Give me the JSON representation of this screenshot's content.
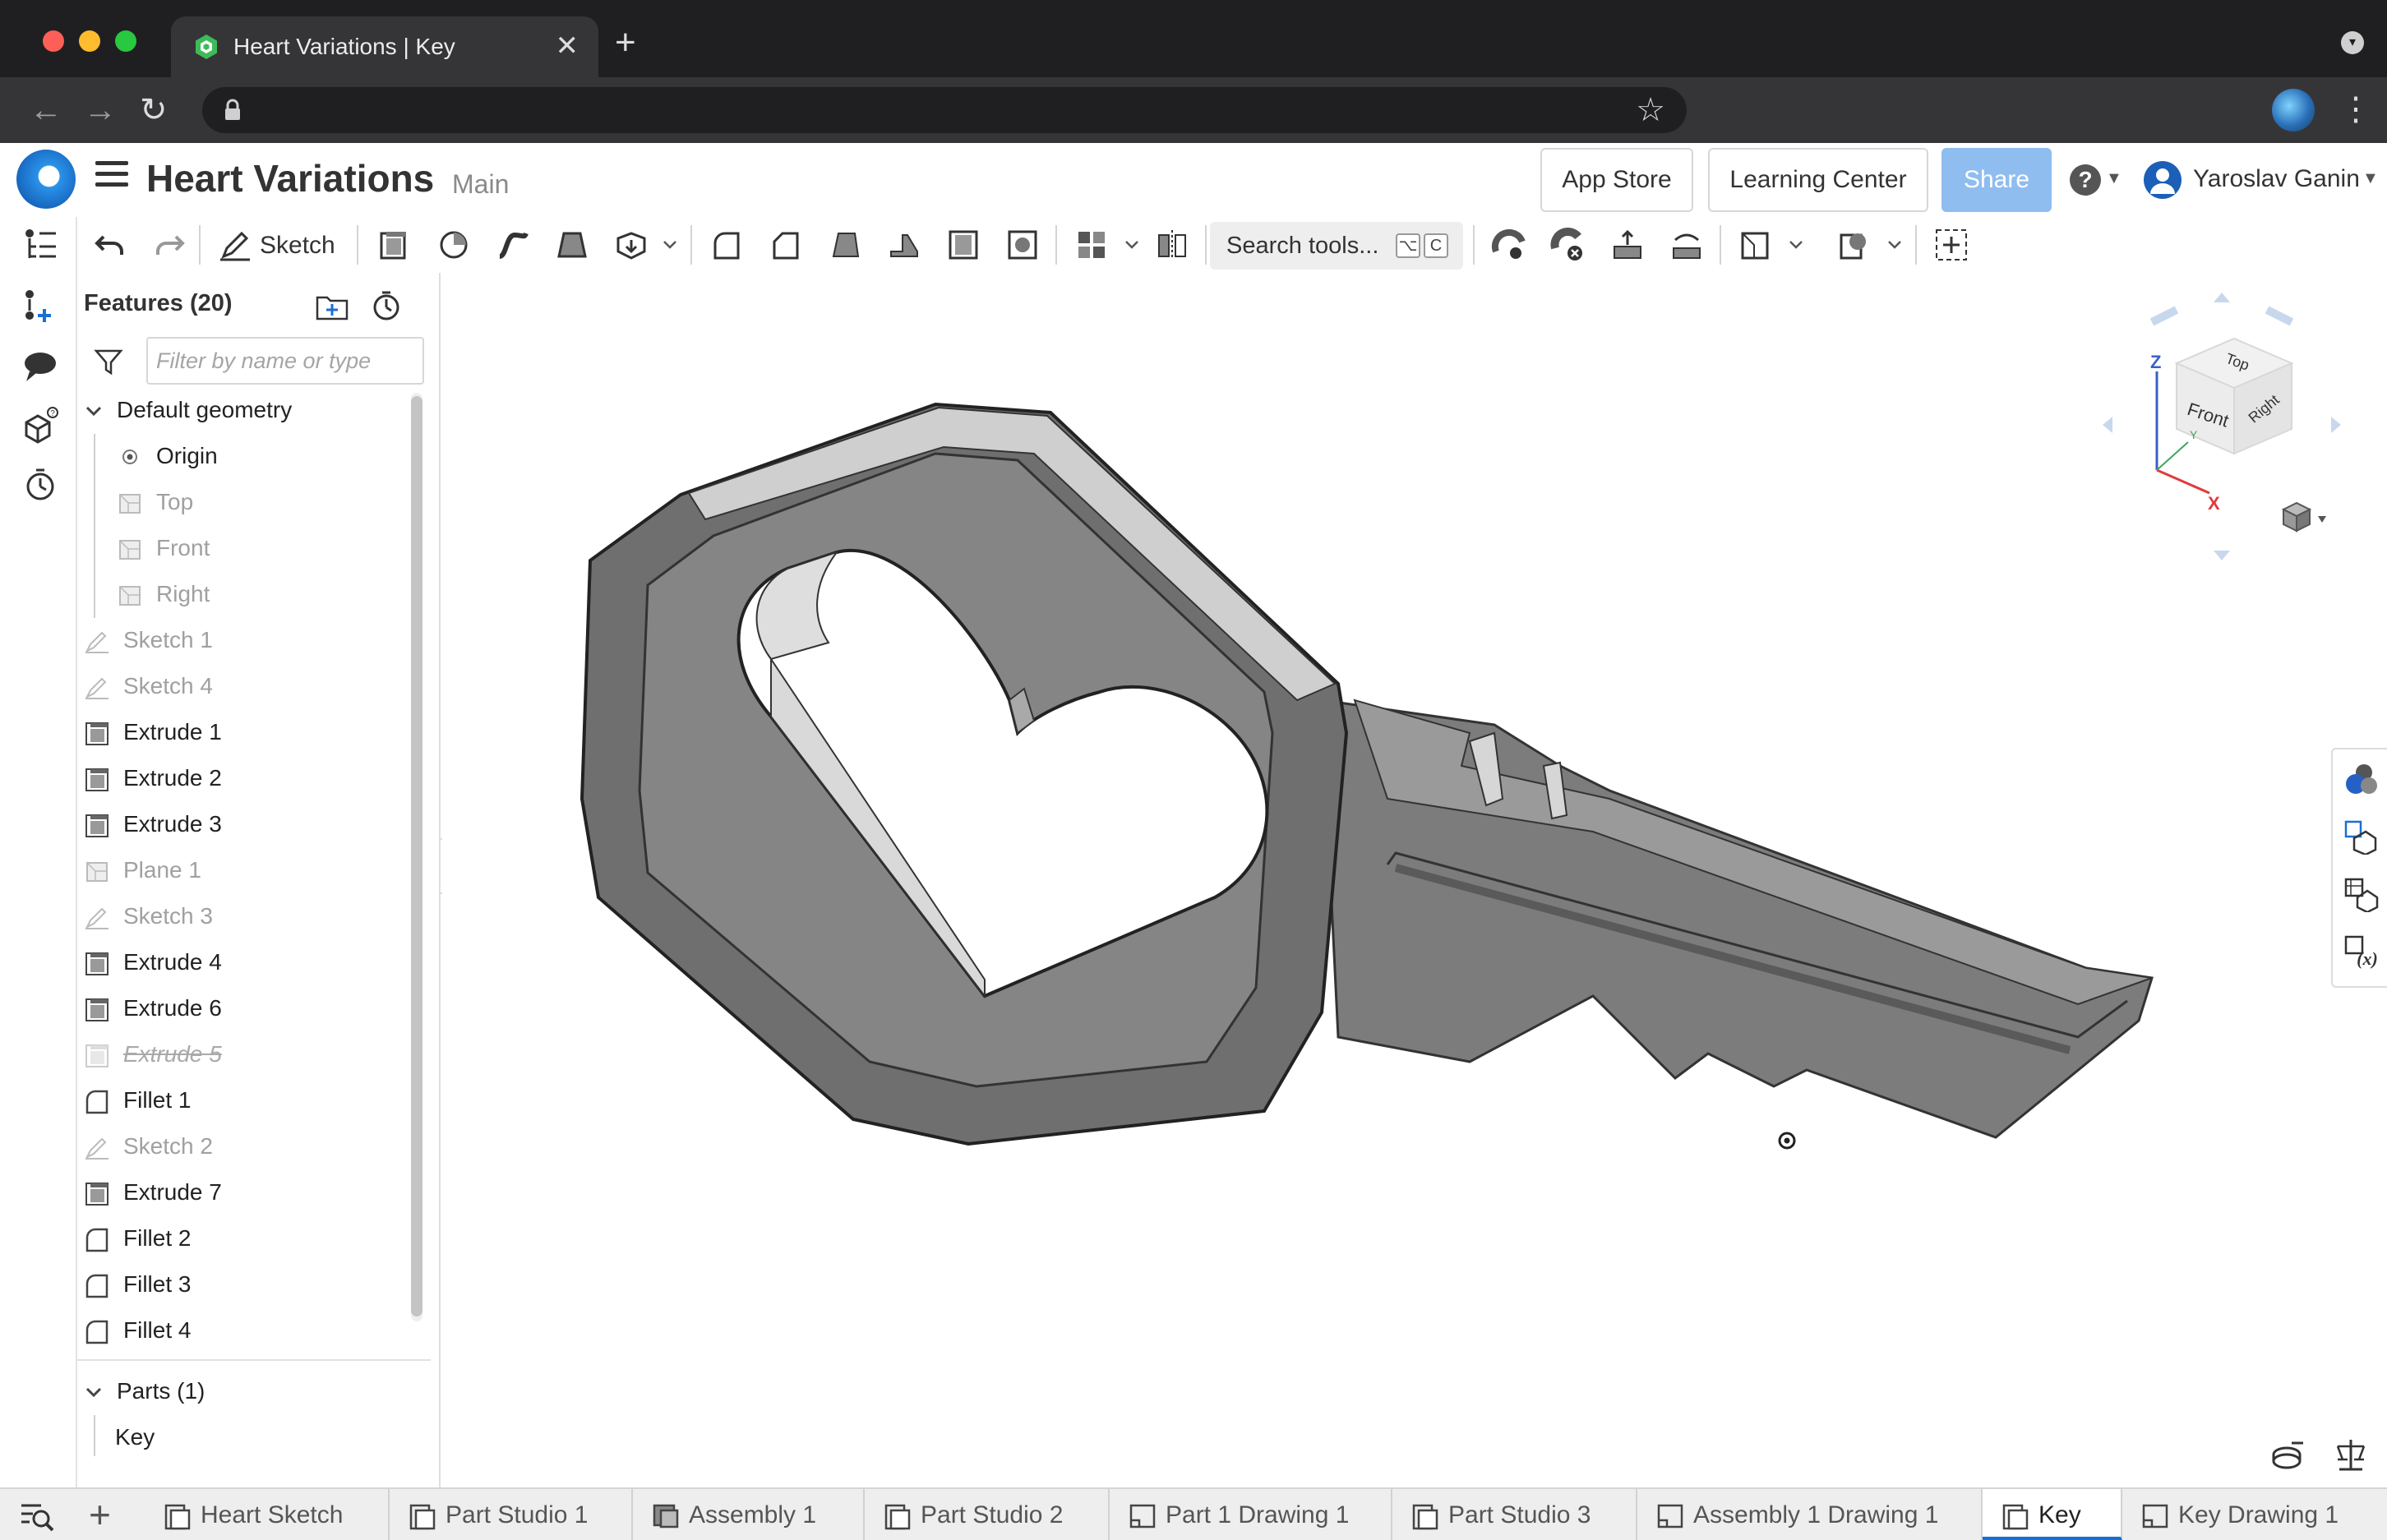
{
  "browser": {
    "tab_title": "Heart Variations | Key",
    "new_tab_symbol": "+",
    "tab_close_symbol": "✕",
    "address": ""
  },
  "header": {
    "doc_title": "Heart Variations",
    "workspace": "Main",
    "app_store": "App Store",
    "learning_center": "Learning Center",
    "share": "Share",
    "help_symbol": "?",
    "user_name": "Yaroslav Ganin"
  },
  "toolbar": {
    "sketch_label": "Sketch",
    "search_label": "Search tools...",
    "search_shortcut": [
      "⌥",
      "C"
    ]
  },
  "feature_panel": {
    "title": "Features (20)",
    "filter_placeholder": "Filter by name or type",
    "default_geometry_label": "Default geometry",
    "default_geometry": [
      {
        "label": "Origin",
        "icon": "origin-icon",
        "dim": false
      },
      {
        "label": "Top",
        "icon": "plane-icon",
        "dim": true
      },
      {
        "label": "Front",
        "icon": "plane-icon",
        "dim": true
      },
      {
        "label": "Right",
        "icon": "plane-icon",
        "dim": true
      }
    ],
    "features": [
      {
        "label": "Sketch 1",
        "icon": "sketch-icon",
        "state": "dim"
      },
      {
        "label": "Sketch 4",
        "icon": "sketch-icon",
        "state": "dim"
      },
      {
        "label": "Extrude 1",
        "icon": "extrude-icon",
        "state": "normal"
      },
      {
        "label": "Extrude 2",
        "icon": "extrude-icon",
        "state": "normal"
      },
      {
        "label": "Extrude 3",
        "icon": "extrude-icon",
        "state": "normal"
      },
      {
        "label": "Plane 1",
        "icon": "plane-icon",
        "state": "dim"
      },
      {
        "label": "Sketch 3",
        "icon": "sketch-icon",
        "state": "dim"
      },
      {
        "label": "Extrude 4",
        "icon": "extrude-icon",
        "state": "normal"
      },
      {
        "label": "Extrude 6",
        "icon": "extrude-icon",
        "state": "normal"
      },
      {
        "label": "Extrude 5",
        "icon": "extrude-icon",
        "state": "suppressed"
      },
      {
        "label": "Fillet 1",
        "icon": "fillet-icon",
        "state": "normal"
      },
      {
        "label": "Sketch 2",
        "icon": "sketch-icon",
        "state": "dim"
      },
      {
        "label": "Extrude 7",
        "icon": "extrude-icon",
        "state": "normal"
      },
      {
        "label": "Fillet 2",
        "icon": "fillet-icon",
        "state": "normal"
      },
      {
        "label": "Fillet 3",
        "icon": "fillet-icon",
        "state": "normal"
      },
      {
        "label": "Fillet 4",
        "icon": "fillet-icon",
        "state": "normal"
      }
    ],
    "parts_label": "Parts (1)",
    "parts": [
      "Key"
    ]
  },
  "view_cube": {
    "top": "Top",
    "front": "Front",
    "right": "Right",
    "axis_x": "X",
    "axis_y": "Y",
    "axis_z": "Z"
  },
  "doc_tabs": [
    {
      "label": "Heart Sketch",
      "icon": "part-studio-icon",
      "active": false
    },
    {
      "label": "Part Studio 1",
      "icon": "part-studio-icon",
      "active": false
    },
    {
      "label": "Assembly 1",
      "icon": "assembly-icon",
      "active": false
    },
    {
      "label": "Part Studio 2",
      "icon": "part-studio-icon",
      "active": false
    },
    {
      "label": "Part 1 Drawing 1",
      "icon": "drawing-icon",
      "active": false
    },
    {
      "label": "Part Studio 3",
      "icon": "part-studio-icon",
      "active": false
    },
    {
      "label": "Assembly 1 Drawing 1",
      "icon": "drawing-icon",
      "active": false
    },
    {
      "label": "Key",
      "icon": "part-studio-icon",
      "active": true
    },
    {
      "label": "Key Drawing 1",
      "icon": "drawing-icon",
      "active": false
    }
  ],
  "colors": {
    "chrome_dark": "#1f1f21",
    "chrome_mid": "#353538",
    "accent_blue": "#1b6fd3",
    "share_bg": "#90bdf0",
    "model_gray": "#7a7a7a"
  }
}
